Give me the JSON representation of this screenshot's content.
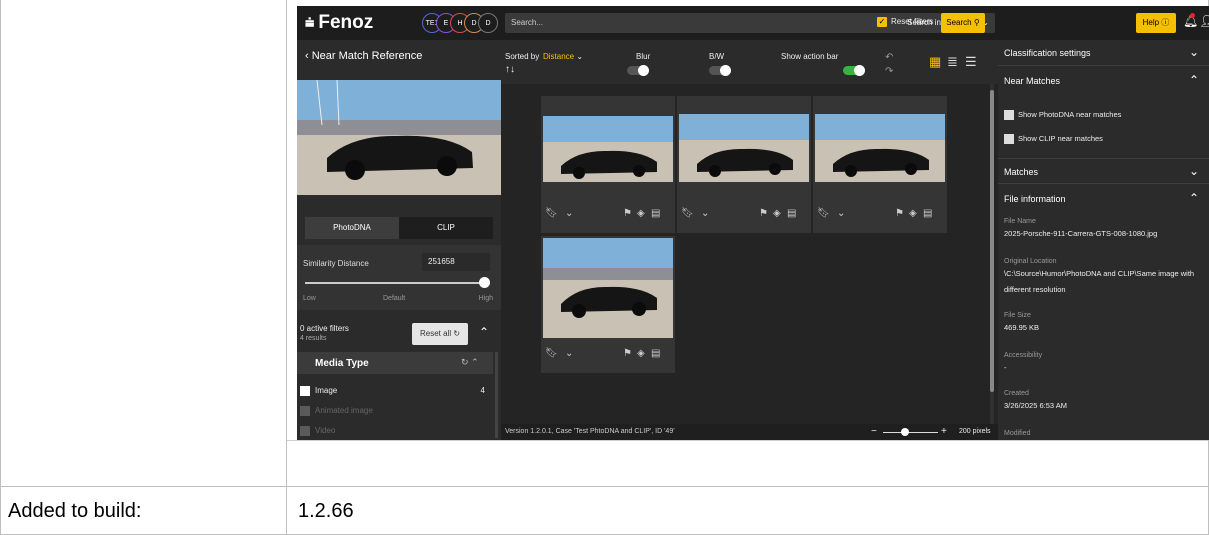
{
  "doc": {
    "build_label": "Added to build:",
    "build_value": "1.2.66"
  },
  "app": {
    "logo": "Fenoz",
    "orgs": [
      "TE1",
      "E",
      "H",
      "D",
      "D"
    ],
    "search_placeholder": "Search...",
    "search_scope": "Search in everything",
    "reset_filters_label": "Reset filters",
    "search_button": "Search",
    "help_button": "Help"
  },
  "left": {
    "title": "Near Match Reference",
    "tabs": [
      "PhotoDNA",
      "CLIP"
    ],
    "similarity_label": "Similarity Distance",
    "similarity_value": "251658",
    "slider_low": "Low",
    "slider_default": "Default",
    "slider_high": "High",
    "active_filters": "0 active filters",
    "results": "4 results",
    "reset_all": "Reset all",
    "media_type_title": "Media Type",
    "media_types": [
      {
        "label": "Image",
        "count": "4"
      },
      {
        "label": "Animated image",
        "count": ""
      },
      {
        "label": "Video",
        "count": ""
      }
    ]
  },
  "center": {
    "sorted_by_label": "Sorted by",
    "sorted_by_value": "Distance",
    "blur_label": "Blur",
    "bw_label": "B/W",
    "action_bar_label": "Show action bar",
    "version_text": "Version 1.2.0.1, Case 'Test PhtoDNA and CLIP', ID '49'",
    "zoom_value": "200 pixels"
  },
  "right": {
    "classification": "Classification settings",
    "near_matches": "Near Matches",
    "show_photodna": "Show PhotoDNA near matches",
    "show_clip": "Show CLIP near matches",
    "matches": "Matches",
    "file_information": "File information",
    "file_name_label": "File Name",
    "file_name_value": "2025-Porsche-911-Carrera-GTS-008-1080.jpg",
    "location_label": "Original Location",
    "location_value": "\\C:\\Source\\Humor\\PhotoDNA and CLIP\\Same image with different resolution",
    "size_label": "File Size",
    "size_value": "469.95 KB",
    "accessibility_label": "Accessibility",
    "accessibility_value": "-",
    "created_label": "Created",
    "created_value": "3/26/2025 6:53 AM",
    "modified_label": "Modified"
  },
  "colors": {
    "accent": "#f5c000",
    "toggle_on": "#3cb043",
    "panel": "#2b2b2b"
  }
}
